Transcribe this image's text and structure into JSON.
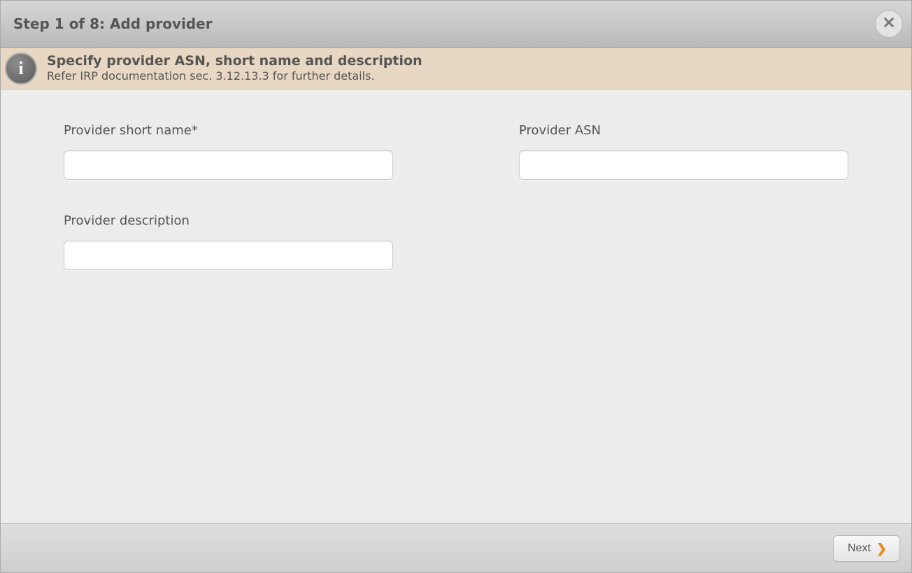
{
  "header": {
    "title": "Step 1 of 8: Add provider"
  },
  "banner": {
    "title": "Specify provider ASN, short name and description",
    "subtitle": "Refer IRP documentation sec. 3.12.13.3 for further details."
  },
  "fields": {
    "shortname": {
      "label": "Provider short name*",
      "value": ""
    },
    "asn": {
      "label": "Provider ASN",
      "value": ""
    },
    "desc": {
      "label": "Provider description",
      "value": ""
    }
  },
  "footer": {
    "next_label": "Next"
  }
}
